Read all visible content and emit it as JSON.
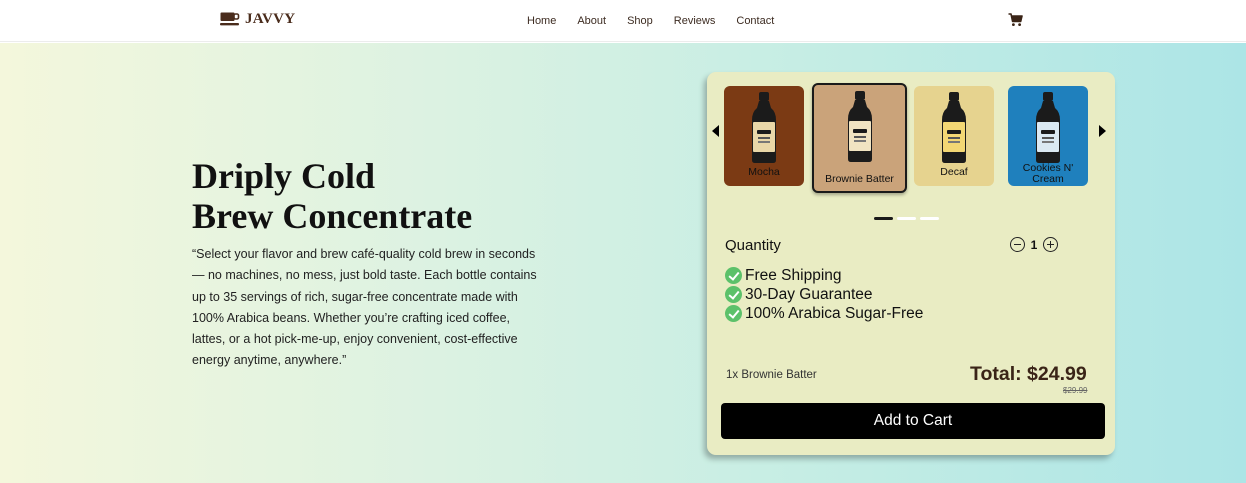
{
  "nav": {
    "logo_text": "JAVVY",
    "logo_icon": "coffee-cup-icon",
    "links": [
      "Home",
      "About",
      "Shop",
      "Reviews",
      "Contact"
    ],
    "cart_icon": "shopping-cart-icon"
  },
  "hero": {
    "title_line1": "Driply Cold",
    "title_line2": "Brew Concentrate",
    "description": "“Select your flavor and brew café-quality cold brew in seconds — no machines, no mess, just bold taste. Each bottle contains up to 35 servings of rich, sugar-free concentrate made with 100% Arabica beans. Whether you’re crafting iced coffee, lattes, or a hot pick-me-up, enjoy convenient, cost-effective energy anytime, anywhere.”"
  },
  "product_card": {
    "flavors": [
      {
        "label": "Mocha",
        "color": "#7b3a14",
        "selected": false
      },
      {
        "label": "Brownie Batter",
        "color": "#caa37a",
        "selected": true
      },
      {
        "label": "Decaf",
        "color": "#e6d38f",
        "selected": false
      },
      {
        "label": "Cookies N' Cream",
        "color": "#1f80bd",
        "selected": false
      }
    ],
    "carousel_pages": 3,
    "carousel_active_index": 0,
    "quantity_label": "Quantity",
    "quantity_value": "1",
    "features": [
      "Free Shipping",
      "30-Day Guarantee",
      "100% Arabica Sugar-Free"
    ],
    "order_summary": "1x Brownie Batter",
    "total": "Total: $24.99",
    "original_price": "$29.99",
    "add_to_cart": "Add to Cart",
    "colors": {
      "card_bg": "#e9ecc3",
      "check_green": "#5cc16a",
      "total_color": "#3a2417"
    }
  }
}
